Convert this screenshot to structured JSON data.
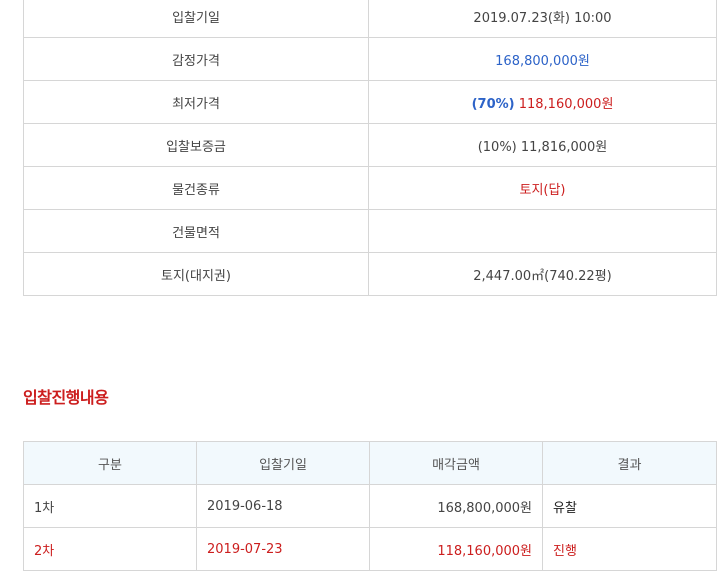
{
  "info": {
    "rows": [
      {
        "label": "입찰기일",
        "value": "2019.07.23(화) 10:00"
      },
      {
        "label": "감정가격",
        "value": "168,800,000원"
      },
      {
        "label": "최저가격",
        "rate": "(70%)",
        "value": "118,160,000원"
      },
      {
        "label": "입찰보증금",
        "value": "(10%) 11,816,000원"
      },
      {
        "label": "물건종류",
        "value": "토지(답)"
      },
      {
        "label": "건물면적",
        "value": ""
      },
      {
        "label": "토지(대지권)",
        "value": "2,447.00㎡(740.22평)"
      }
    ]
  },
  "rounds": {
    "title": "입찰진행내용",
    "headers": [
      "구분",
      "입찰기일",
      "매각금액",
      "결과"
    ],
    "rows": [
      {
        "round": "1차",
        "date": "2019-06-18",
        "amount": "168,800,000원",
        "result": "유찰"
      },
      {
        "round": "2차",
        "date": "2019-07-23",
        "amount": "118,160,000원",
        "result": "진행"
      }
    ]
  },
  "colors": {
    "accent_red": "#cc1e1e",
    "accent_blue": "#2d63c8",
    "header_bg": "#f2f9fd",
    "border": "#d6d6d6"
  }
}
